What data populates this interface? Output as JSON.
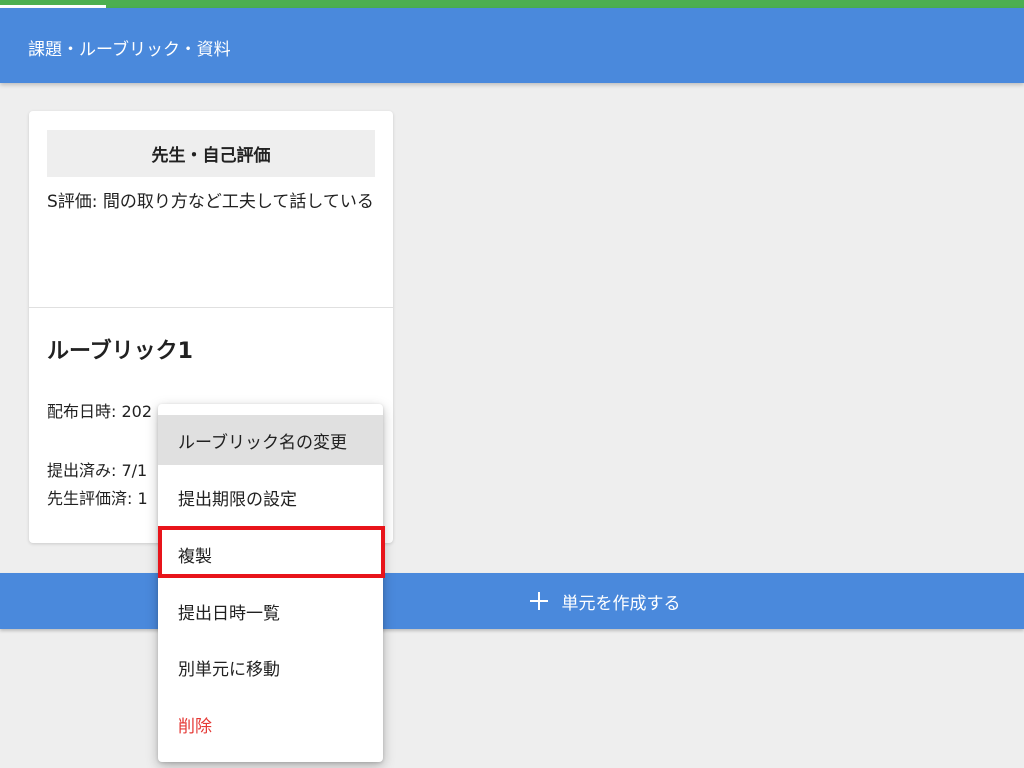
{
  "app_bar": {
    "title": "課題・ルーブリック・資料"
  },
  "card": {
    "criteria_header": "先生・自己評価",
    "criteria_text": "S評価: 間の取り方など工夫して話している",
    "rubric_title": "ルーブリック1",
    "distribution_label": "配布日時: 202",
    "submitted_label": "提出済み: 7/1",
    "teacher_evaluated_label": "先生評価済: 1"
  },
  "create_unit": {
    "icon": "plus-icon",
    "label": "単元を作成する"
  },
  "context_menu": {
    "items": [
      {
        "label": "ルーブリック名の変更",
        "state": "hovered"
      },
      {
        "label": "提出期限の設定"
      },
      {
        "label": "複製",
        "state": "highlighted"
      },
      {
        "label": "提出日時一覧"
      },
      {
        "label": "別単元に移動"
      },
      {
        "label": "削除",
        "state": "danger"
      }
    ]
  },
  "colors": {
    "primary": "#4a89dc",
    "top_strip": "#4caf50",
    "danger": "#e53935",
    "highlight": "#e8141a"
  }
}
